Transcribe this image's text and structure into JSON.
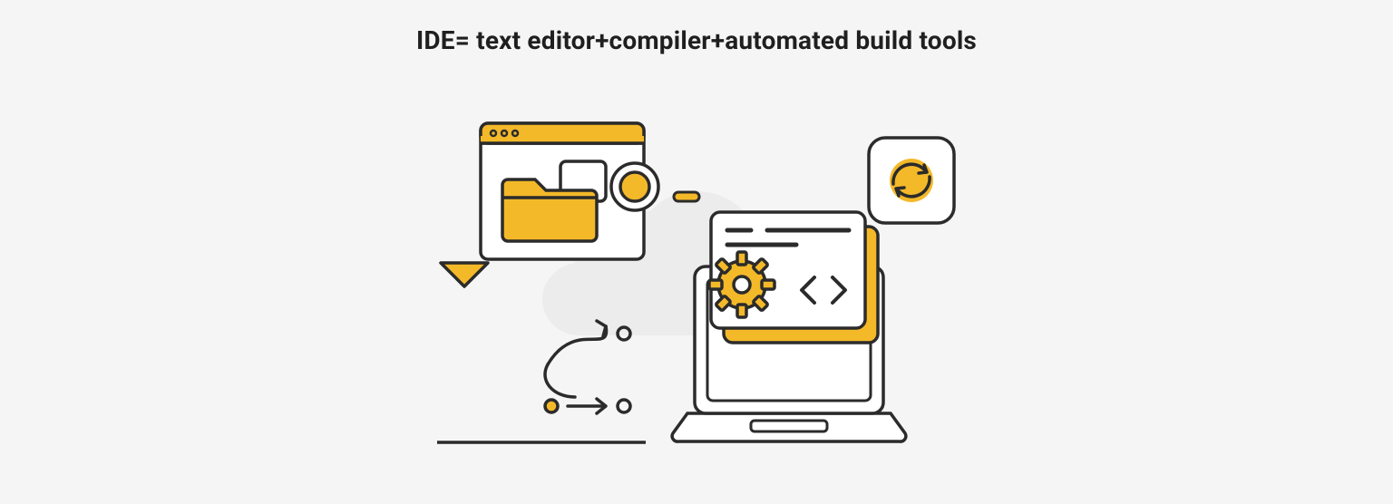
{
  "title": "IDE= text editor+compiler+automated build tools",
  "colors": {
    "bg": "#f5f5f5",
    "stroke": "#2b2b2b",
    "accent": "#f4b929",
    "accentDark": "#e3a820",
    "soft": "#ececec",
    "white": "#ffffff"
  },
  "icons": {
    "cloud": "cloud-icon",
    "window": "browser-window-icon",
    "folder": "folder-icon",
    "search": "magnifier-icon",
    "cursor": "cursor-arrow-icon",
    "flow": "flow-arrows-icon",
    "laptop": "laptop-icon",
    "gear": "gear-icon",
    "code": "code-brackets-icon",
    "sync": "sync-refresh-icon",
    "dash": "accent-dash-icon",
    "underline": "underline-rule"
  }
}
